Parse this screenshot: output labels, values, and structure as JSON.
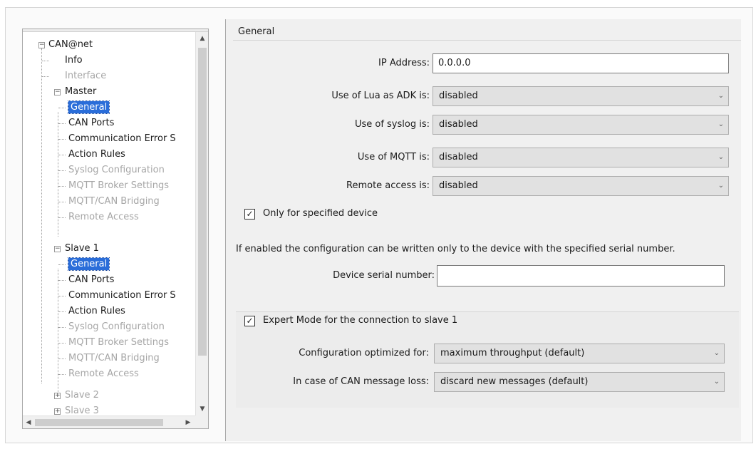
{
  "tree": {
    "items": [
      {
        "label": "CAN@net",
        "state": "normal"
      },
      {
        "label": "Info",
        "state": "normal"
      },
      {
        "label": "Interface",
        "state": "disabled"
      },
      {
        "label": "Master",
        "state": "normal"
      },
      {
        "label": "General",
        "state": "selected"
      },
      {
        "label": "CAN Ports",
        "state": "normal"
      },
      {
        "label": "Communication Error S",
        "state": "normal"
      },
      {
        "label": "Action Rules",
        "state": "normal"
      },
      {
        "label": "Syslog Configuration",
        "state": "disabled"
      },
      {
        "label": "MQTT Broker Settings",
        "state": "disabled"
      },
      {
        "label": "MQTT/CAN Bridging",
        "state": "disabled"
      },
      {
        "label": "Remote Access",
        "state": "disabled"
      },
      {
        "label": "Slave 1",
        "state": "normal"
      },
      {
        "label": "General",
        "state": "selected"
      },
      {
        "label": "CAN Ports",
        "state": "normal"
      },
      {
        "label": "Communication Error S",
        "state": "normal"
      },
      {
        "label": "Action Rules",
        "state": "normal"
      },
      {
        "label": "Syslog Configuration",
        "state": "disabled"
      },
      {
        "label": "MQTT Broker Settings",
        "state": "disabled"
      },
      {
        "label": "MQTT/CAN Bridging",
        "state": "disabled"
      },
      {
        "label": "Remote Access",
        "state": "disabled"
      },
      {
        "label": "Slave 2",
        "state": "disabled"
      },
      {
        "label": "Slave 3",
        "state": "disabled"
      }
    ]
  },
  "scroll": {
    "up_glyph": "▲",
    "down_glyph": "▼",
    "left_glyph": "◀",
    "right_glyph": "▶"
  },
  "general": {
    "title": "General",
    "ip_label": "IP Address:",
    "ip_value": "0.0.0.0",
    "lua_label": "Use of Lua as ADK is:",
    "lua_value": "disabled",
    "syslog_label": "Use of syslog is:",
    "syslog_value": "disabled",
    "mqtt_label": "Use of MQTT is:",
    "mqtt_value": "disabled",
    "remote_label": "Remote access is:",
    "remote_value": "disabled",
    "only_device_label": "Only for specified device",
    "only_device_checked": true,
    "info_text": "If enabled the configuration can be written only to the device with the specified serial number.",
    "serial_label": "Device serial number:",
    "serial_value": "",
    "expert_label": "Expert Mode for the connection to slave 1",
    "expert_checked": true,
    "config_label": "Configuration optimized for:",
    "config_value": "maximum throughput (default)",
    "loss_label": "In case of CAN message loss:",
    "loss_value": "discard new messages (default)"
  },
  "glyphs": {
    "check": "✓",
    "chevron": "⌄",
    "minus": "−",
    "plus": "+"
  },
  "colors": {
    "selection": "#2a6dd9",
    "disabled_text": "#a6a6a6"
  }
}
